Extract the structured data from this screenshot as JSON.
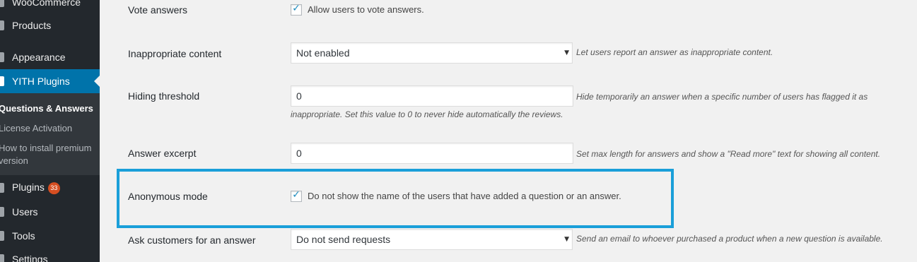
{
  "sidebar": {
    "woocommerce": "WooCommerce",
    "products": "Products",
    "appearance": "Appearance",
    "yith_plugins": "YITH Plugins",
    "submenu": {
      "questions_answers": "Questions & Answers",
      "license_activation": "License Activation",
      "how_to_install_line1": "How to install premium",
      "how_to_install_line2": "version"
    },
    "plugins": "Plugins",
    "plugins_badge": "33",
    "users": "Users",
    "tools": "Tools",
    "settings": "Settings"
  },
  "settings": {
    "vote_answers": {
      "label": "Vote answers",
      "checked": true,
      "checkbox_text": "Allow users to vote answers."
    },
    "inappropriate_content": {
      "label": "Inappropriate content",
      "value": "Not enabled",
      "description": "Let users report an answer as inappropriate content."
    },
    "hiding_threshold": {
      "label": "Hiding threshold",
      "value": "0",
      "description_line1": "Hide temporarily an answer when a specific number of users has flagged it as",
      "description_line2": "inappropriate. Set this value to 0 to never hide automatically the reviews."
    },
    "answer_excerpt": {
      "label": "Answer excerpt",
      "value": "0",
      "description": "Set max length for answers and show a \"Read more\" text for showing all content."
    },
    "anonymous_mode": {
      "label": "Anonymous mode",
      "checked": true,
      "checkbox_text": "Do not show the name of the users that have added a question or an answer."
    },
    "ask_customers": {
      "label": "Ask customers for an answer",
      "value": "Do not send requests",
      "description": "Send an email to whoever purchased a product when a new question is available."
    }
  },
  "colors": {
    "sidebar_bg": "#23282d",
    "active_menu": "#0073aa",
    "highlight_border": "#1a9fd9",
    "badge": "#d54e21"
  }
}
